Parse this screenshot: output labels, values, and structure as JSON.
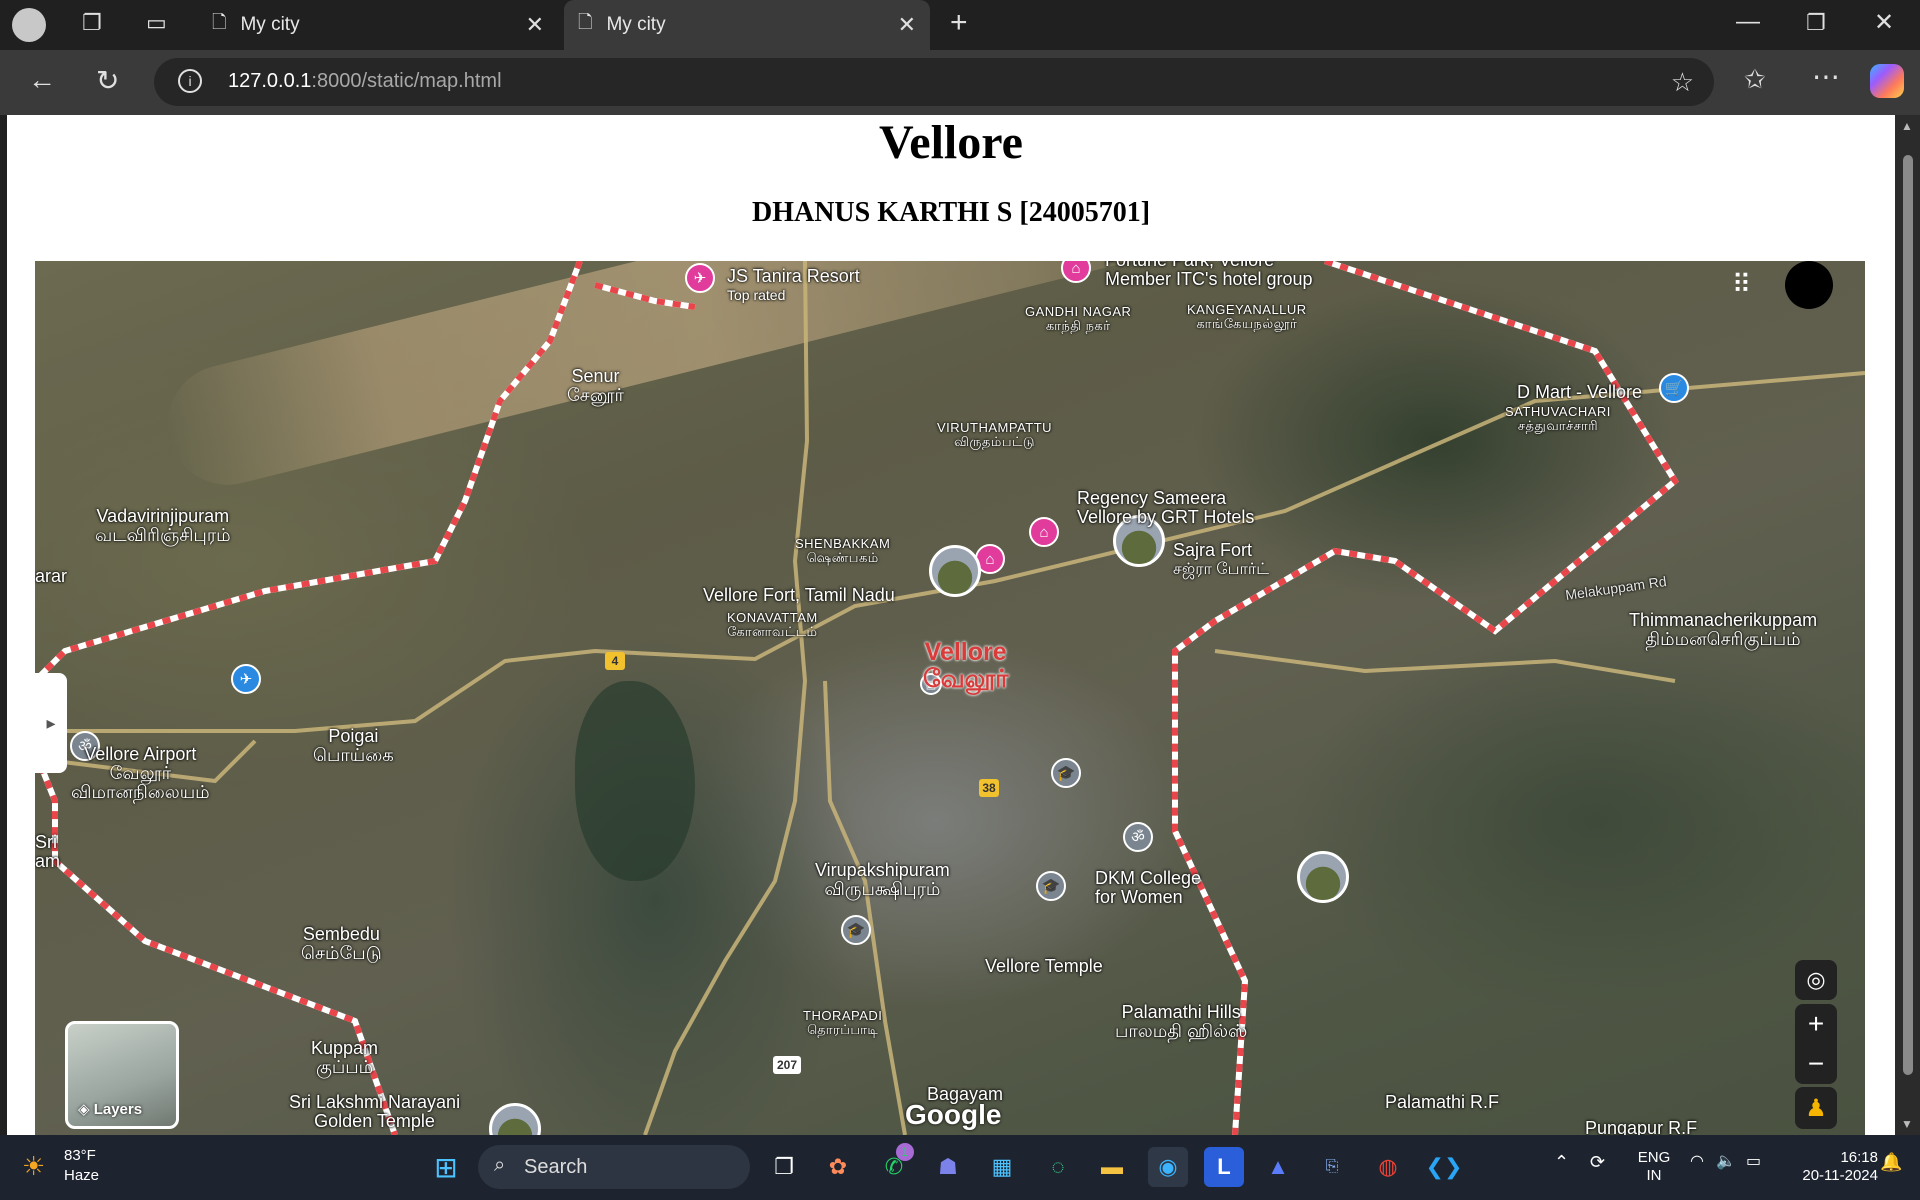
{
  "browser": {
    "tabs": [
      {
        "label": "My city",
        "active": false
      },
      {
        "label": "My city",
        "active": true
      }
    ],
    "url_host": "127.0.0.1",
    "url_rest": ":8000/static/map.html"
  },
  "page": {
    "title": "Vellore",
    "subtitle": "DHANUS KARTHI S [24005701]"
  },
  "map": {
    "labels": {
      "js_tanira": "JS Tanira Resort",
      "js_tanira_sub": "Top rated",
      "fortune_park": "Fortune Park, Vellore",
      "fortune_park_sub": "Member ITC's hotel group",
      "gandhi_nagar": "GANDHI NAGAR",
      "gandhi_nagar_ta": "காந்தி நகர்",
      "kangeyanallur": "KANGEYANALLUR",
      "kangeyanallur_ta": "காங்கேயநல்லூர்",
      "senur": "Senur",
      "senur_ta": "சேனூர்",
      "viruthampattu": "VIRUTHAMPATTU",
      "viruthampattu_ta": "விருதம்பட்டு",
      "d_mart": "D Mart - Vellore",
      "sathuvachari": "SATHUVACHARI",
      "sathuvachari_ta": "சத்துவாச்சாரி",
      "vadavirinjipuram": "Vadavirinjipuram",
      "vadavirinjipuram_ta": "வடவிரிஞ்சிபுரம்",
      "regency": "Regency Sameera",
      "regency_sub": "Vellore by GRT Hotels",
      "shenbakkam": "SHENBAKKAM",
      "shenbakkam_ta": "ஷெண்பகம்",
      "sajra_fort": "Sajra Fort",
      "sajra_fort_ta": "சஜ்ரா போர்ட்",
      "arar": "arar",
      "vellore_fort": "Vellore Fort, Tamil Nadu",
      "konavattam": "KONAVATTAM",
      "konavattam_ta": "கோனாவட்டம்",
      "melakuppam_rd": "Melakuppam Rd",
      "thimmanacherikuppam": "Thimmanacherikuppam",
      "thimmanacherikuppam_ta": "திம்மனசெரிகுப்பம்",
      "vellore_city": "Vellore",
      "vellore_city_ta": "வேலூர்",
      "vellore_airport": "Vellore Airport",
      "vellore_airport_ta": "வேலூர்",
      "vellore_airport_ta2": "விமானநிலையம்",
      "poigai": "Poigai",
      "poigai_ta": "பொய்கை",
      "sri_am": "Sri",
      "sri_am2": "am",
      "virupakshipuram": "Virupakshipuram",
      "virupakshipuram_ta": "விருபக்ஷிபுரம்",
      "dkm_college": "DKM College",
      "dkm_college_sub": "for Women",
      "sembedu": "Sembedu",
      "sembedu_ta": "செம்பேடு",
      "vellore_temple": "Vellore Temple",
      "thorapadi": "THORAPADI",
      "thorapadi_ta": "தொரப்பாடி",
      "palamathi_hills": "Palamathi Hills",
      "palamathi_hills_ta": "பாலமதி ஹில்ஸ்",
      "kuppam": "Kuppam",
      "kuppam_ta": "குப்பம்",
      "sri_lakshmi": "Sri Lakshmi Narayani",
      "golden_temple": "Golden Temple",
      "bagayam": "Bagayam",
      "palamathi_rf": "Palamathi R.F",
      "pungapur_rf": "Pungapur R.F"
    },
    "route_shields": [
      "4",
      "4",
      "38",
      "207"
    ],
    "layers_label": "Layers",
    "google_logo": "Google"
  },
  "taskbar": {
    "weather_temp": "83°F",
    "weather_desc": "Haze",
    "search_label": "Search",
    "whatsapp_badge": "1",
    "lang_top": "ENG",
    "lang_bottom": "IN",
    "time": "16:18",
    "date": "20-11-2024"
  },
  "colors": {
    "boundary": "#e8464a",
    "poi_pink": "#e13b9c",
    "poi_blue": "#2a8ae2",
    "city_label": "#d93a3a"
  }
}
